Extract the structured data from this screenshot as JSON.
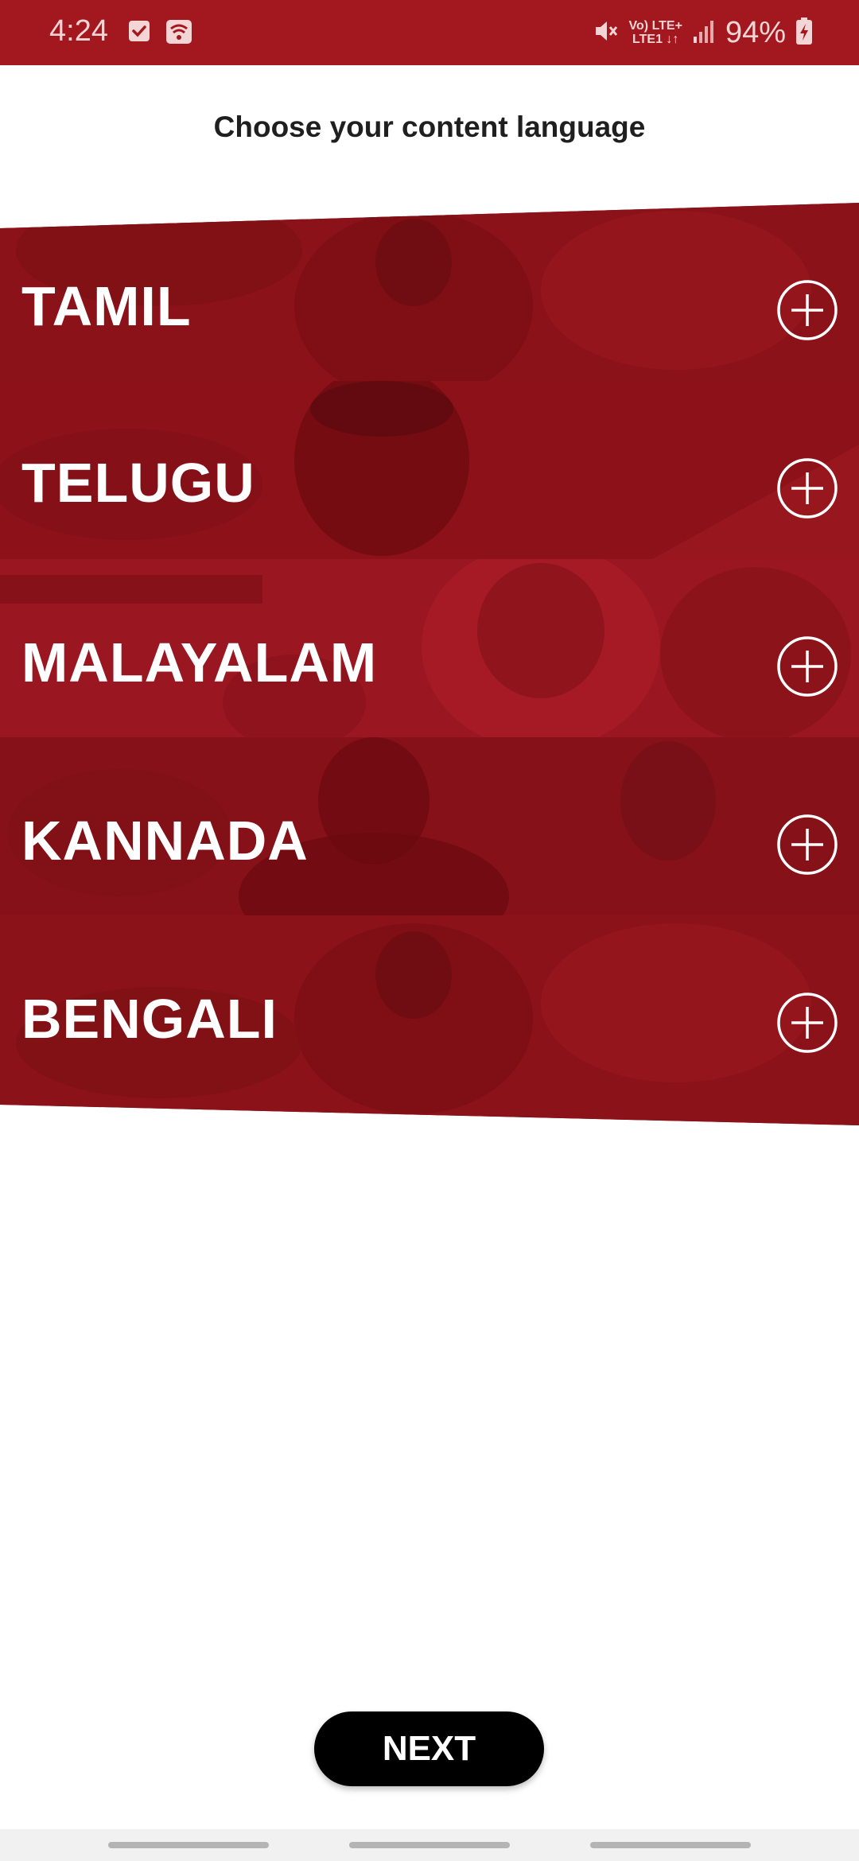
{
  "status_bar": {
    "time": "4:24",
    "left_icons": [
      "check-square-icon",
      "wifi-hotspot-icon"
    ],
    "right_icons": [
      "mute-icon",
      "signal-icon",
      "battery-charging-icon"
    ],
    "network_top": "Vo) LTE+",
    "network_bottom": "LTE1 ↓↑",
    "battery": "94%"
  },
  "header": {
    "title": "Choose your content language"
  },
  "languages": [
    {
      "label": "TAMIL",
      "action_icon": "plus-circle-icon"
    },
    {
      "label": "TELUGU",
      "action_icon": "plus-circle-icon"
    },
    {
      "label": "MALAYALAM",
      "action_icon": "plus-circle-icon"
    },
    {
      "label": "KANNADA",
      "action_icon": "plus-circle-icon"
    },
    {
      "label": "BENGALI",
      "action_icon": "plus-circle-icon"
    }
  ],
  "footer": {
    "next_label": "NEXT"
  },
  "colors": {
    "status_bar": "#a3171f",
    "band": "#8e1219",
    "button": "#000000",
    "label": "#ffffff"
  }
}
